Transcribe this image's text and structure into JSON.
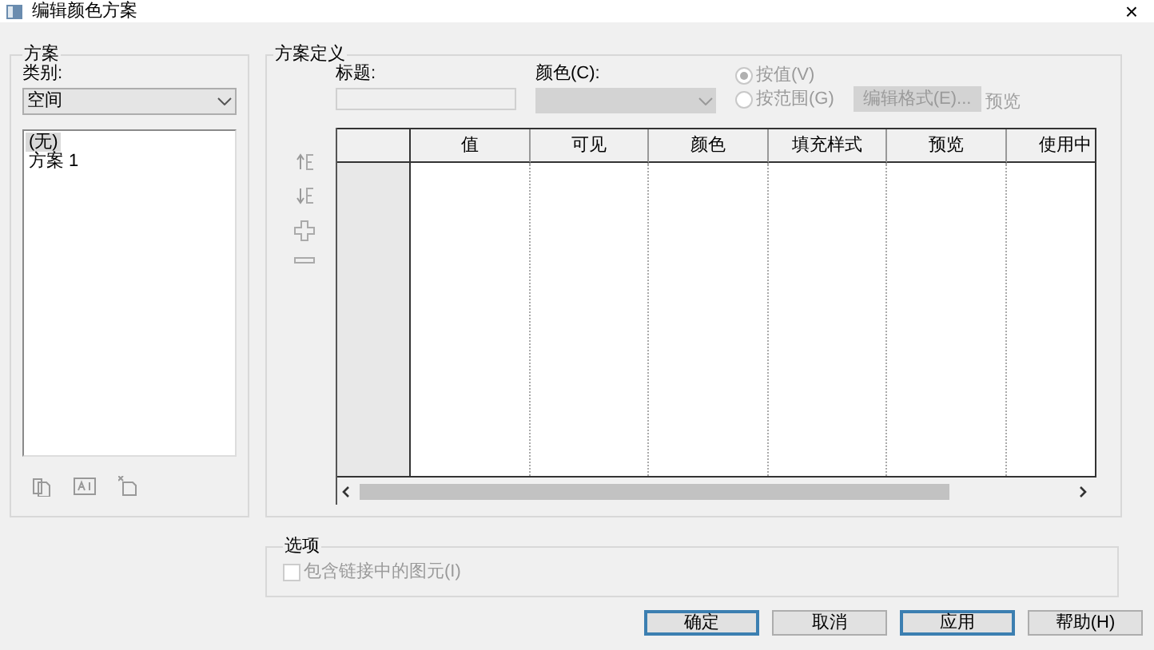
{
  "window": {
    "title": "编辑颜色方案",
    "close": "×"
  },
  "scheme": {
    "title": "方案",
    "category_label": "类别:",
    "category_value": "空间",
    "items": [
      {
        "label": "(无)",
        "selected": true
      },
      {
        "label": "方案 1",
        "selected": false
      }
    ]
  },
  "definition": {
    "title": "方案定义",
    "caption_label": "标题:",
    "color_label": "颜色(C):",
    "radios": [
      {
        "label": "按值(V)",
        "selected": true,
        "disabled": true
      },
      {
        "label": "按范围(G)",
        "selected": false,
        "disabled": true
      }
    ],
    "edit_format_button": {
      "label": "编辑格式(E)...",
      "disabled": true
    },
    "preview_label": "预览",
    "table": {
      "columns": [
        "值",
        "可见",
        "颜色",
        "填充样式",
        "预览",
        "使用中"
      ]
    }
  },
  "options": {
    "title": "选项",
    "checkbox": {
      "label": "包含链接中的图元(I)",
      "checked": false,
      "disabled": true
    }
  },
  "buttons": [
    {
      "label": "确定",
      "default": true
    },
    {
      "label": "取消",
      "default": false
    },
    {
      "label": "应用",
      "default": true
    },
    {
      "label": "帮助(H)",
      "default": false
    }
  ]
}
